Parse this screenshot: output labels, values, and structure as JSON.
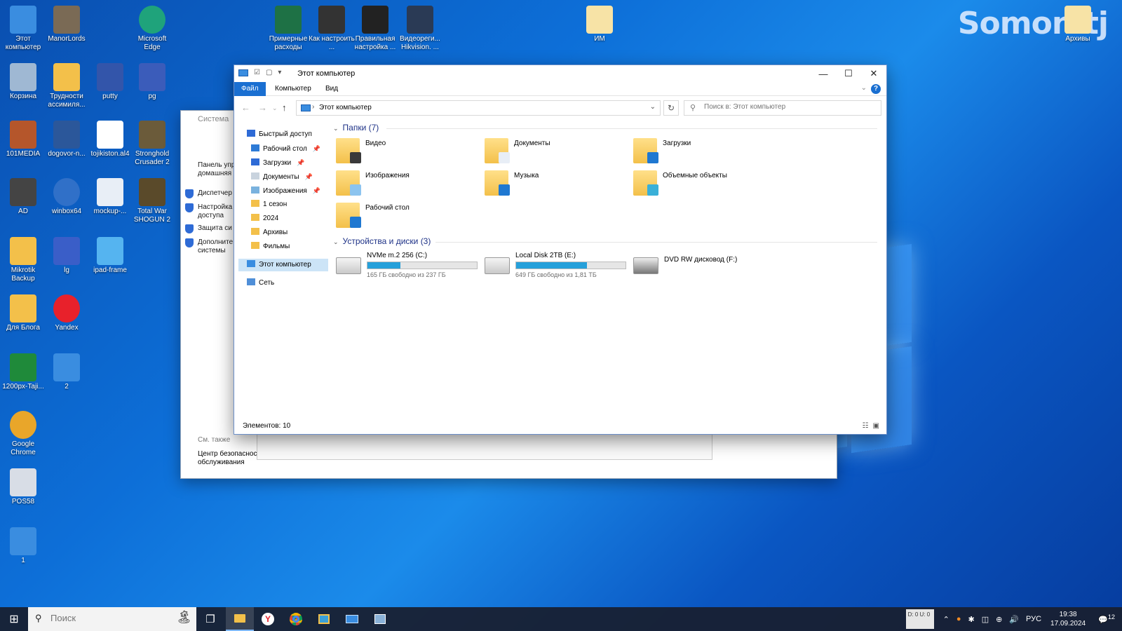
{
  "watermark": "Somon.tj",
  "desktop_icons": [
    {
      "label": "Этот компьютер",
      "icon": "computer-icon",
      "color": "#3a8de0"
    },
    {
      "label": "ManorLords",
      "icon": "game-icon",
      "color": "#7a6a55"
    },
    {
      "label": "Microsoft Edge",
      "icon": "edge-icon",
      "color": "#1fa37b"
    },
    {
      "label": "Корзина",
      "icon": "recycle-bin-icon",
      "color": "#9fb8d3"
    },
    {
      "label": "Трудности ассимиля...",
      "icon": "folder-icon",
      "color": "#f3c04a"
    },
    {
      "label": "putty",
      "icon": "putty-icon",
      "color": "#3355aa"
    },
    {
      "label": "pg",
      "icon": "pg-icon",
      "color": "#3b5cba"
    },
    {
      "label": "101MEDIA",
      "icon": "archive-icon",
      "color": "#b5562b"
    },
    {
      "label": "dogovor-n...",
      "icon": "word-icon",
      "color": "#2b579a"
    },
    {
      "label": "tojikiston.al4",
      "icon": "file-icon",
      "color": "#ffffff"
    },
    {
      "label": "Stronghold Crusader 2",
      "icon": "game-icon",
      "color": "#6b5b3a"
    },
    {
      "label": "AD",
      "icon": "archive-icon",
      "color": "#444444"
    },
    {
      "label": "winbox64",
      "icon": "winbox-icon",
      "color": "#3070c8"
    },
    {
      "label": "mockup-...",
      "icon": "image-icon",
      "color": "#e8eef6"
    },
    {
      "label": "Total War SHOGUN 2",
      "icon": "game-icon",
      "color": "#5a4a2a"
    },
    {
      "label": "Mikrotik Backup",
      "icon": "folder-icon",
      "color": "#f3c04a"
    },
    {
      "label": "lg",
      "icon": "lg-icon",
      "color": "#3a5ec8"
    },
    {
      "label": "ipad-frame",
      "icon": "image-icon",
      "color": "#55b4f0"
    },
    {
      "label": "Для Блога",
      "icon": "folder-icon",
      "color": "#f3c04a"
    },
    {
      "label": "Yandex",
      "icon": "yandex-icon",
      "color": "#e8212b"
    },
    {
      "label": "1200px-Taji...",
      "icon": "flag-icon",
      "color": "#1f8a3a"
    },
    {
      "label": "2",
      "icon": "shortcut-icon",
      "color": "#3a8de0"
    },
    {
      "label": "Google Chrome",
      "icon": "chrome-icon",
      "color": "#e9a62a"
    },
    {
      "label": "POS58",
      "icon": "printer-icon",
      "color": "#d8dde6"
    },
    {
      "label": "1",
      "icon": "shortcut-icon",
      "color": "#3a8de0"
    },
    {
      "label": "Примерные расходы",
      "icon": "excel-icon",
      "color": "#1e7145"
    },
    {
      "label": "Как настроить ...",
      "icon": "video-icon",
      "color": "#333333"
    },
    {
      "label": "Правильная настройка ...",
      "icon": "video-icon",
      "color": "#222222"
    },
    {
      "label": "Видеореги... Hikvision. ...",
      "icon": "video-icon",
      "color": "#2a3a55"
    },
    {
      "label": "ИМ",
      "icon": "folder-icon",
      "color": "#f7e3a6"
    },
    {
      "label": "Архивы",
      "icon": "folder-icon",
      "color": "#f7e3a6"
    }
  ],
  "back_window": {
    "title": "Система",
    "nav": [
      "Панель упр домашняя",
      "Диспетчер",
      "Настройка доступа",
      "Защита си",
      "Дополните системы"
    ],
    "see_also": "См. также",
    "security_link": "Центр безопаснос обслуживания"
  },
  "explorer": {
    "title": "Этот компьютер",
    "ribbon_tabs": [
      "Файл",
      "Компьютер",
      "Вид"
    ],
    "help": "?",
    "address": "Этот компьютер",
    "search_placeholder": "Поиск в: Этот компьютер",
    "nav": [
      {
        "label": "Быстрый доступ",
        "icon": "star-icon",
        "pinned": false
      },
      {
        "label": "Рабочий стол",
        "icon": "desktop-icon",
        "pinned": true
      },
      {
        "label": "Загрузки",
        "icon": "download-icon",
        "pinned": true
      },
      {
        "label": "Документы",
        "icon": "documents-icon",
        "pinned": true
      },
      {
        "label": "Изображения",
        "icon": "pictures-icon",
        "pinned": true
      },
      {
        "label": "1 сезон",
        "icon": "folder-icon",
        "pinned": false
      },
      {
        "label": "2024",
        "icon": "folder-icon",
        "pinned": false
      },
      {
        "label": "Архивы",
        "icon": "folder-icon",
        "pinned": false
      },
      {
        "label": "Фильмы",
        "icon": "folder-icon",
        "pinned": false
      },
      {
        "label": "Этот компьютер",
        "icon": "computer-icon",
        "pinned": false
      },
      {
        "label": "Сеть",
        "icon": "network-icon",
        "pinned": false
      }
    ],
    "folders_header": "Папки (7)",
    "folders": [
      {
        "name": "Видео",
        "icon": "video-folder-icon",
        "badge": "#3a3a3a"
      },
      {
        "name": "Документы",
        "icon": "documents-folder-icon",
        "badge": "#e8eef6"
      },
      {
        "name": "Загрузки",
        "icon": "downloads-folder-icon",
        "badge": "#1f78d1"
      },
      {
        "name": "Изображения",
        "icon": "pictures-folder-icon",
        "badge": "#8cc4ef"
      },
      {
        "name": "Музыка",
        "icon": "music-folder-icon",
        "badge": "#1f78d1"
      },
      {
        "name": "Объемные объекты",
        "icon": "3d-objects-folder-icon",
        "badge": "#3ab0d8"
      },
      {
        "name": "Рабочий стол",
        "icon": "desktop-folder-icon",
        "badge": "#1f78d1"
      }
    ],
    "drives_header": "Устройства и диски (3)",
    "drives": [
      {
        "name": "NVMe m.2 256 (C:)",
        "free": "165 ГБ свободно из 237 ГБ",
        "used_fraction": 0.3,
        "icon": "windows-drive-icon"
      },
      {
        "name": "Local Disk 2TB (E:)",
        "free": "649 ГБ свободно из 1,81 ТБ",
        "used_fraction": 0.65,
        "icon": "hdd-icon"
      },
      {
        "name": "DVD RW дисковод (F:)",
        "free": "",
        "used_fraction": null,
        "icon": "dvd-drive-icon"
      }
    ],
    "status": "Элементов: 10"
  },
  "taskbar": {
    "search_placeholder": "Поиск",
    "lang": "РУС",
    "time": "19:38",
    "date": "17.09.2024",
    "notifications": "12",
    "key_indicator": "D: 0 U: 0"
  }
}
